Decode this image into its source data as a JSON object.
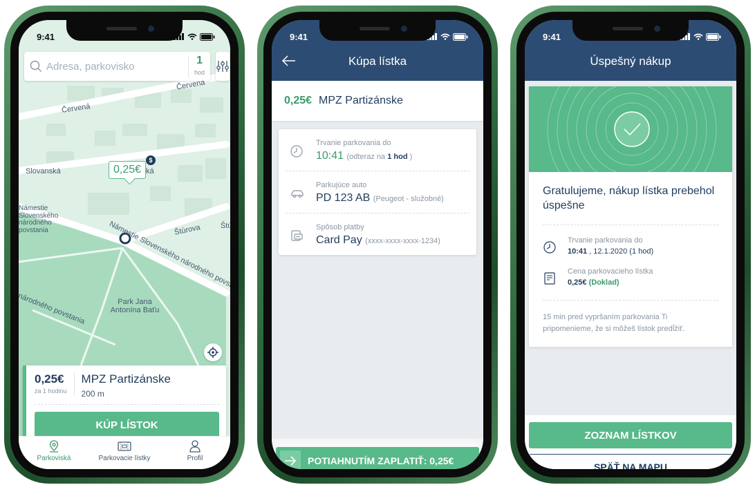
{
  "status_bar": {
    "time": "9:41"
  },
  "map_screen": {
    "search": {
      "placeholder": "Adresa, parkovisko",
      "hours_value": "1",
      "hours_unit": "hod"
    },
    "streets": [
      "Červená",
      "Červená",
      "Slovanská",
      "Námestie Slovenského národného povstania",
      "Štúrova",
      "Štú",
      "Námestie Slovenského národného povstania",
      "národného povstania",
      "Park Jana Antonína Baťu",
      "ká"
    ],
    "price_pin": "0,25€",
    "pin_badge": "$",
    "parking_card": {
      "price": "0,25€",
      "per": "za 1 hodinu",
      "name": "MPZ Partizánske",
      "distance": "200 m",
      "buy_label": "KÚP LÍSTOK"
    },
    "tabs": [
      {
        "label": "Parkoviská",
        "icon": "location-pin-icon",
        "active": true
      },
      {
        "label": "Parkovacie lístky",
        "icon": "ticket-icon",
        "active": false
      },
      {
        "label": "Profil",
        "icon": "user-icon",
        "active": false
      }
    ]
  },
  "purchase_screen": {
    "title": "Kúpa lístka",
    "summary": {
      "price": "0,25€",
      "name": "MPZ Partizánske"
    },
    "details": [
      {
        "icon": "clock-icon",
        "label": "Trvanie parkovania do",
        "value": "10:41",
        "sub_prefix": "(odteraz na ",
        "sub_bold": "1 hod",
        "sub_suffix": " )"
      },
      {
        "icon": "car-icon",
        "label": "Parkujúce auto",
        "value": "PD 123 AB",
        "sub": "(Peugeot - služobné)"
      },
      {
        "icon": "card-icon",
        "label": "Spôsob platby",
        "value": "Card Pay",
        "sub": "(xxxx-xxxx-xxxx-1234)"
      }
    ],
    "pay_label": "POTIAHNUTÍM ZAPLATIŤ: 0,25€"
  },
  "success_screen": {
    "title": "Úspešný nákup",
    "message": "Gratulujeme, nákup lístka prebehol úspešne",
    "rows": [
      {
        "icon": "clock-icon",
        "label": "Trvanie parkovania do",
        "value_bold": "10:41",
        "value_rest": " , 12.1.2020 (1 hod)"
      },
      {
        "icon": "receipt-icon",
        "label": "Cena parkovacieho lístka",
        "value_bold": "0,25€",
        "link": "(Doklad)"
      }
    ],
    "note": "15 min pred vypršaním parkovania Ti pripomenieme, že si môžeš lístok predĺžiť.",
    "primary_button": "ZOZNAM LÍSTKOV",
    "secondary_button": "SPÄŤ NA MAPU"
  },
  "colors": {
    "green": "#58b98a",
    "navy": "#2d4c73",
    "text": "#1f3b5c",
    "map": "#dff0e6"
  }
}
